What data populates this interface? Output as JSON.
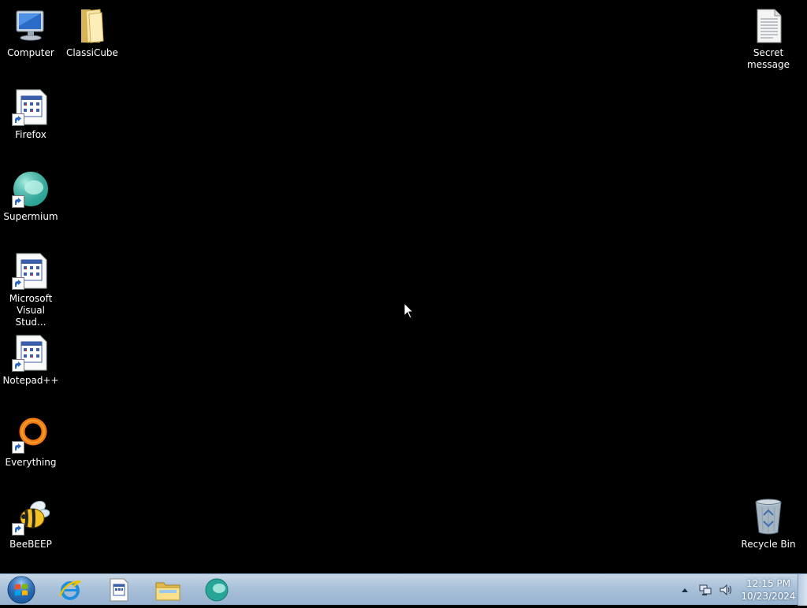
{
  "desktop": {
    "icons": {
      "computer": {
        "label": "Computer"
      },
      "classicube": {
        "label": "ClassiCube"
      },
      "secret": {
        "label": "Secret\nmessage"
      },
      "firefox": {
        "label": "Firefox"
      },
      "supermium": {
        "label": "Supermium"
      },
      "vstudio": {
        "label": "Microsoft\nVisual Stud..."
      },
      "notepadpp": {
        "label": "Notepad++"
      },
      "everything": {
        "label": "Everything"
      },
      "beebeep": {
        "label": "BeeBEEP"
      },
      "recycle": {
        "label": "Recycle Bin"
      }
    }
  },
  "taskbar": {
    "clock": {
      "time": "12:15 PM",
      "date": "10/23/2024"
    },
    "pinned": [
      "internet-explorer",
      "app-window",
      "file-explorer",
      "supermium"
    ]
  },
  "colors": {
    "desktop": "#000000",
    "taskbar": "#a9c1d9"
  }
}
